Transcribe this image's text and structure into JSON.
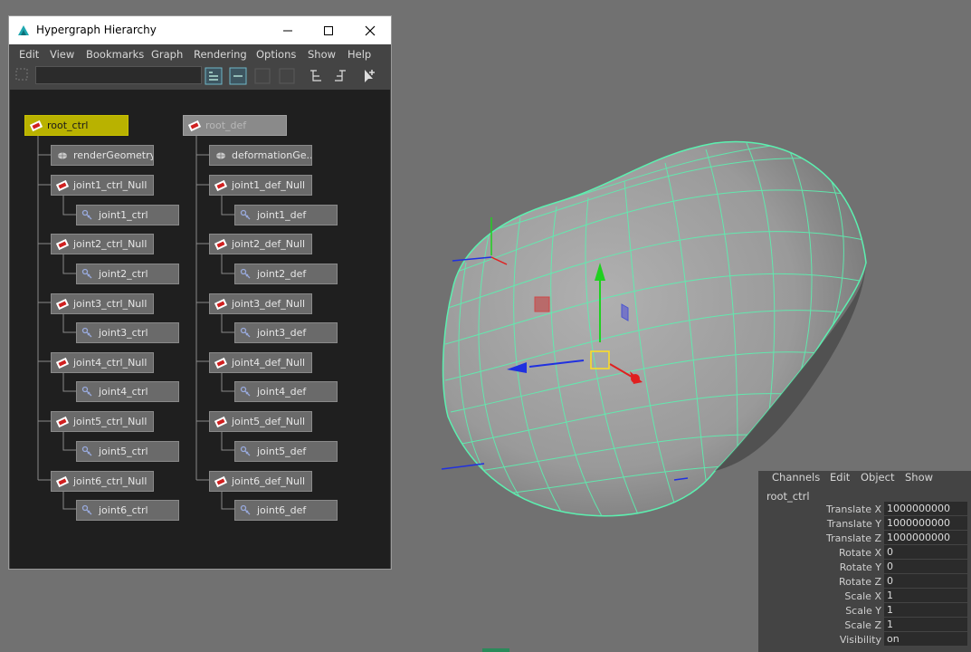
{
  "hypergraph": {
    "title": "Hypergraph Hierarchy",
    "menu": [
      "Edit",
      "View",
      "Bookmarks",
      "Graph",
      "Rendering",
      "Options",
      "Show",
      "Help"
    ],
    "filter_value": "",
    "ctrl_column": {
      "root": "root_ctrl",
      "geometry": "renderGeometry",
      "groups": [
        {
          "null": "joint1_ctrl_Null",
          "joint": "joint1_ctrl"
        },
        {
          "null": "joint2_ctrl_Null",
          "joint": "joint2_ctrl"
        },
        {
          "null": "joint3_ctrl_Null",
          "joint": "joint3_ctrl"
        },
        {
          "null": "joint4_ctrl_Null",
          "joint": "joint4_ctrl"
        },
        {
          "null": "joint5_ctrl_Null",
          "joint": "joint5_ctrl"
        },
        {
          "null": "joint6_ctrl_Null",
          "joint": "joint6_ctrl"
        }
      ]
    },
    "def_column": {
      "root": "root_def",
      "geometry": "deformationGe...",
      "groups": [
        {
          "null": "joint1_def_Null",
          "joint": "joint1_def"
        },
        {
          "null": "joint2_def_Null",
          "joint": "joint2_def"
        },
        {
          "null": "joint3_def_Null",
          "joint": "joint3_def"
        },
        {
          "null": "joint4_def_Null",
          "joint": "joint4_def"
        },
        {
          "null": "joint5_def_Null",
          "joint": "joint5_def"
        },
        {
          "null": "joint6_def_Null",
          "joint": "joint6_def"
        }
      ]
    }
  },
  "channel_box": {
    "menu": [
      "Channels",
      "Edit",
      "Object",
      "Show"
    ],
    "object": "root_ctrl",
    "attributes": [
      {
        "label": "Translate X",
        "value": "1000000000"
      },
      {
        "label": "Translate Y",
        "value": "1000000000"
      },
      {
        "label": "Translate Z",
        "value": "1000000000"
      },
      {
        "label": "Rotate X",
        "value": "0"
      },
      {
        "label": "Rotate Y",
        "value": "0"
      },
      {
        "label": "Rotate Z",
        "value": "0"
      },
      {
        "label": "Scale X",
        "value": "1"
      },
      {
        "label": "Scale Y",
        "value": "1"
      },
      {
        "label": "Scale Z",
        "value": "1"
      },
      {
        "label": "Visibility",
        "value": "on"
      }
    ]
  },
  "colors": {
    "selected_root": "#b9b200",
    "wireframe": "#5cf0b0",
    "axis_x": "#e02020",
    "axis_y": "#20d020",
    "axis_z": "#2030e0"
  },
  "icons": {
    "app": "hypergraph-app-icon",
    "transform": "transform-node-icon",
    "joint": "joint-node-icon",
    "geometry": "geometry-node-icon"
  }
}
